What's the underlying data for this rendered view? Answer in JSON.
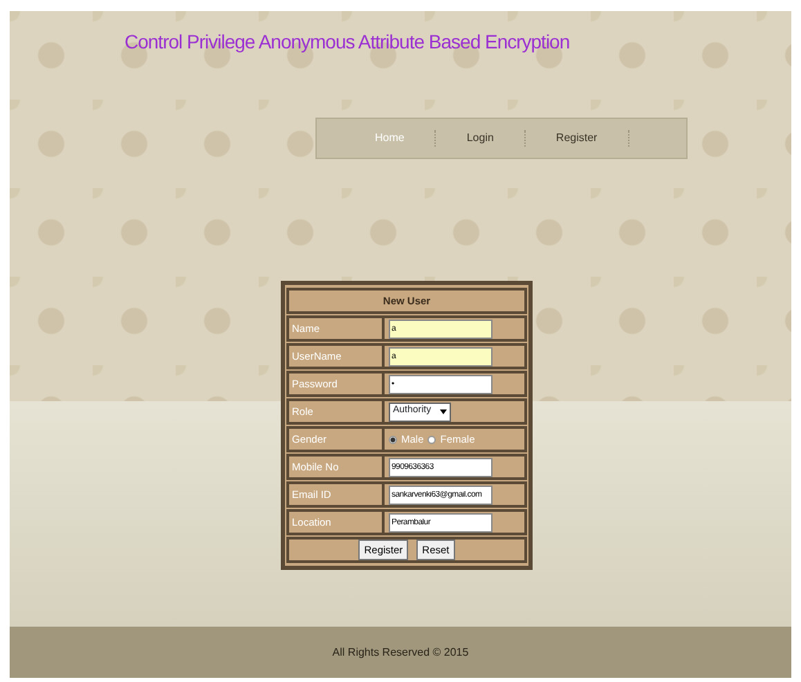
{
  "site_title": "Control Privilege Anonymous Attribute Based Encryption",
  "nav": [
    {
      "label": "Home",
      "selected": true
    },
    {
      "label": "Login",
      "selected": false
    },
    {
      "label": "Register",
      "selected": false
    }
  ],
  "form": {
    "title": "New User",
    "fields": [
      {
        "kind": "text",
        "label": "Name",
        "value": "a",
        "highlighted": true
      },
      {
        "kind": "text",
        "label": "UserName",
        "value": "a",
        "highlighted": true
      },
      {
        "kind": "password",
        "label": "Password",
        "value": "•",
        "highlighted": false
      },
      {
        "kind": "select",
        "label": "Role",
        "value": "Authority"
      },
      {
        "kind": "radio",
        "label": "Gender",
        "options": [
          {
            "label": "Male",
            "selected": true
          },
          {
            "label": "Female",
            "selected": false
          }
        ]
      },
      {
        "kind": "text",
        "label": "Mobile No",
        "value": "9909636363",
        "highlighted": false
      },
      {
        "kind": "text",
        "label": "Email ID",
        "value": "sankarvenki63@gmail.com",
        "highlighted": false
      },
      {
        "kind": "text",
        "label": "Location",
        "value": "Perambalur",
        "highlighted": false
      }
    ],
    "buttons": [
      "Register",
      "Reset"
    ]
  },
  "footer": "All Rights Reserved © 2015"
}
